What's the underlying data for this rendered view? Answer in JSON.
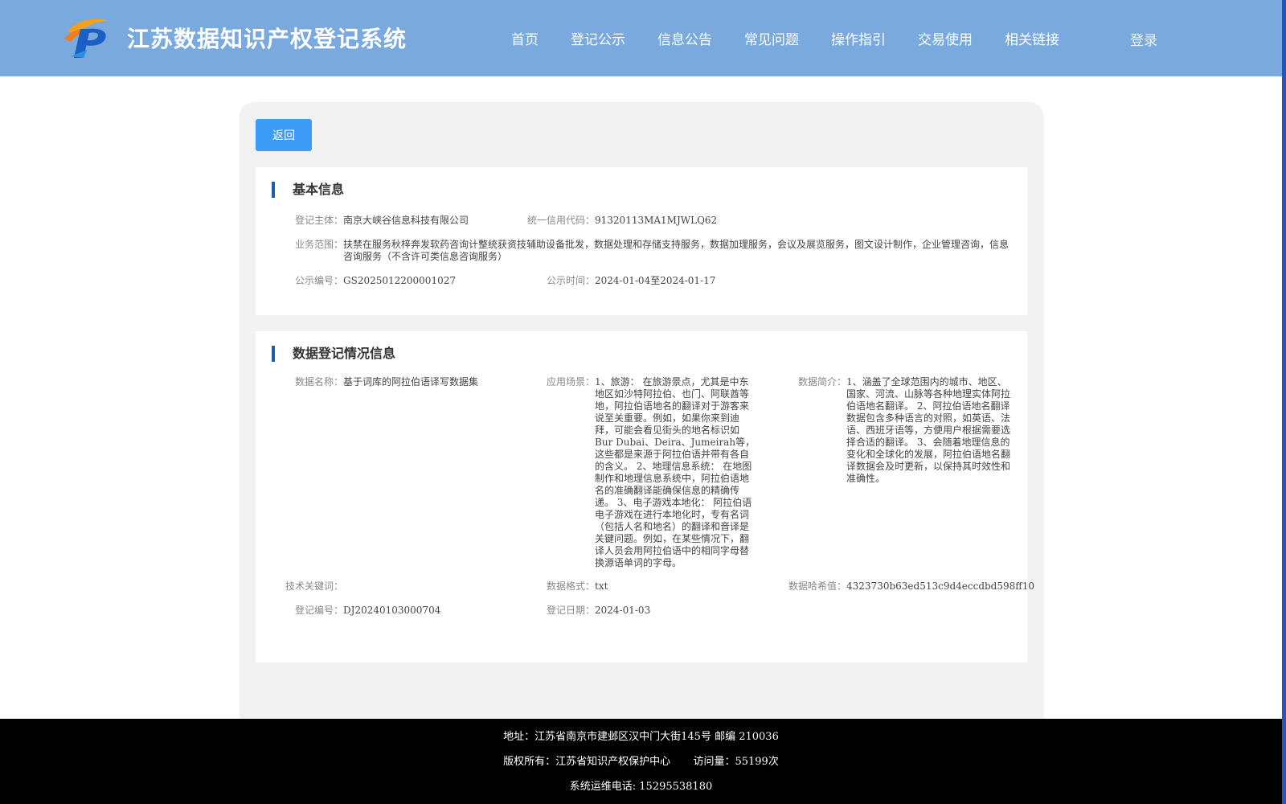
{
  "header": {
    "site_title": "江苏数据知识产权登记系统",
    "nav": [
      "首页",
      "登记公示",
      "信息公告",
      "常见问题",
      "操作指引",
      "交易使用",
      "相关链接"
    ],
    "login": "登录",
    "colors": {
      "header_bg": "#79a9dd",
      "accent": "#1f5da8",
      "button": "#3d9cf5"
    }
  },
  "main": {
    "back_label": "返回",
    "basic": {
      "title": "基本信息",
      "subject_label": "登记主体：",
      "subject_value": "南京大峡谷信息科技有限公司",
      "credit_label": "统一信用代码：",
      "credit_value": "91320113MA1MJWLQ62",
      "scope_label": "业务范围：",
      "scope_value": "扶禁在服务秋梓奔发软药咨询计整统获资技辅助设备批发，数据处理和存储支持服务，数据加理服务，会议及展览服务，图文设计制作，企业管理咨询，信息咨询服务（不含许可类信息咨询服务）",
      "pub_no_label": "公示编号：",
      "pub_no_value": "GS2025012200001027",
      "pub_time_label": "公示时间：",
      "pub_time_value": "2024-01-04至2024-01-17"
    },
    "data": {
      "title": "数据登记情况信息",
      "name_label": "数据名称：",
      "name_value": "基于词库的阿拉伯语译写数据集",
      "scene_label": "应用场景：",
      "scene_value": "1、旅游： 在旅游景点，尤其是中东地区如沙特阿拉伯、也门、阿联酋等地，阿拉伯语地名的翻译对于游客来说至关重要。例如，如果你来到迪拜，可能会看见街头的地名标识如Bur Dubai、Deira、Jumeirah等，这些都是来源于阿拉伯语并带有各自的含义。 2、地理信息系统： 在地图制作和地理信息系统中，阿拉伯语地名的准确翻译能确保信息的精确传递。 3、电子游戏本地化： 阿拉伯语电子游戏在进行本地化时，专有名词（包括人名和地名）的翻译和音译是关键问题。例如，在某些情况下，翻译人员会用阿拉伯语中的相同字母替换源语单词的字母。",
      "intro_label": "数据简介：",
      "intro_value": "1、涵盖了全球范围内的城市、地区、国家、河流、山脉等各种地理实体阿拉伯语地名翻译。 2、阿拉伯语地名翻译数据包含多种语言的对照，如英语、法语、西班牙语等，方便用户根据需要选择合适的翻译。 3、会随着地理信息的变化和全球化的发展，阿拉伯语地名翻译数据会及时更新，以保持其时效性和准确性。",
      "keyword_label": "技术关键词：",
      "keyword_value": "",
      "format_label": "数据格式：",
      "format_value": "txt",
      "hash_label": "数据哈希值：",
      "hash_value": "4323730b63ed513c9d4eccdbd598ff10",
      "reg_no_label": "登记编号：",
      "reg_no_value": "DJ20240103000704",
      "reg_date_label": "登记日期：",
      "reg_date_value": "2024-01-03"
    }
  },
  "footer": {
    "address": "地址：江苏省南京市建邺区汉中门大街145号 邮编 210036",
    "copyright": "版权所有：江苏省知识产权保护中心",
    "visits": "访问量：55199次",
    "phone": "系统运维电话: 15295538180"
  }
}
